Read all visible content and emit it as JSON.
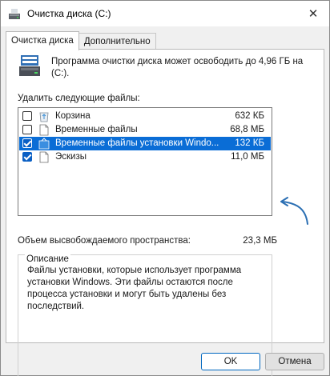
{
  "window": {
    "title": "Очистка диска  (C:)"
  },
  "tabs": [
    {
      "label": "Очистка диска",
      "active": true
    },
    {
      "label": "Дополнительно",
      "active": false
    }
  ],
  "intro": {
    "text": "Программа очистки диска может освободить до 4,96 ГБ на  (C:)."
  },
  "files_list": {
    "label": "Удалить следующие файлы:",
    "items": [
      {
        "label": "Корзина",
        "size": "632 КБ",
        "checked": false,
        "selected": false,
        "icon": "recycle-bin-icon"
      },
      {
        "label": "Временные файлы",
        "size": "68,8 МБ",
        "checked": false,
        "selected": false,
        "icon": "file-icon"
      },
      {
        "label": "Временные файлы установки Windo...",
        "size": "132 КБ",
        "checked": true,
        "selected": true,
        "icon": "setup-icon"
      },
      {
        "label": "Эскизы",
        "size": "11,0 МБ",
        "checked": true,
        "selected": false,
        "icon": "file-icon"
      }
    ]
  },
  "freed": {
    "label": "Объем высвобождаемого пространства:",
    "value": "23,3 МБ"
  },
  "description": {
    "legend": "Описание",
    "text": "Файлы установки, которые использует программа установки Windows.  Эти файлы остаются после процесса установки и могут быть удалены без последствий."
  },
  "buttons": {
    "ok": "OK",
    "cancel": "Отмена"
  },
  "colors": {
    "selection": "#0a6dd6",
    "arrow": "#2b6fb3",
    "accent": "#0067c0"
  }
}
